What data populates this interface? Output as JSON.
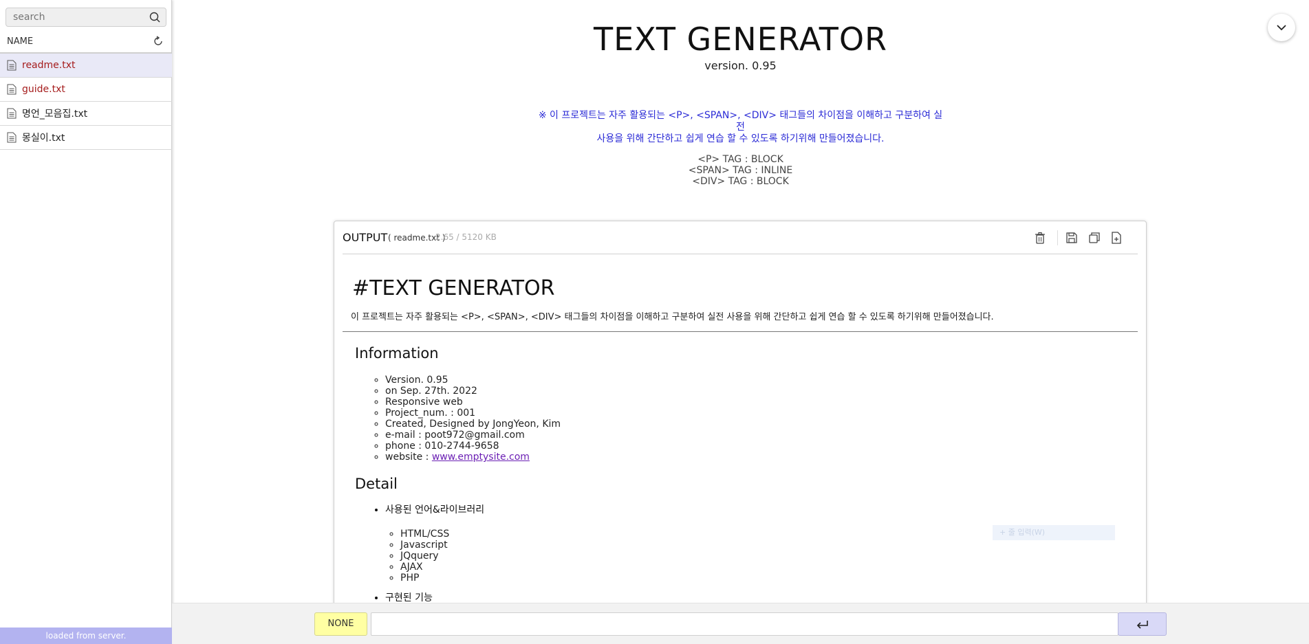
{
  "sidebar": {
    "search_placeholder": "search",
    "column_header": "NAME",
    "files": [
      {
        "name": "readme.txt",
        "selected": true
      },
      {
        "name": "guide.txt",
        "selected": false
      },
      {
        "name": "명언_모음집.txt",
        "selected": false
      },
      {
        "name": "몽실이.txt",
        "selected": false
      }
    ],
    "status": "loaded from server."
  },
  "header": {
    "title": "TEXT GENERATOR",
    "version": "version. 0.95",
    "notice_line1": "※ 이 프로젝트는 자주 활용되는 <P>, <SPAN>, <DIV> 태그들의 차이점을 이해하고 구분하여 실전",
    "notice_line2": "사용을 위해 간단하고 쉽게 연습 할 수 있도록 하기위해 만들어졌습니다.",
    "tags": [
      "<P> TAG : BLOCK",
      "<SPAN> TAG : INLINE",
      "<DIV> TAG : BLOCK"
    ]
  },
  "output": {
    "label": "OUTPUT",
    "file": "( readme.txt )",
    "size": "2.65 / 5120 KB",
    "doc": {
      "h1": "#TEXT GENERATOR",
      "intro": "이 프로젝트는 자주 활용되는 <P>, <SPAN>, <DIV> 태그들의 차이점을 이해하고 구분하여 실전 사용을 위해 간단하고 쉽게 연습 할 수 있도록 하기위해 만들어졌습니다.",
      "info_heading": "Information",
      "info": [
        "Version. 0.95",
        "on Sep. 27th. 2022",
        "Responsive web",
        "Project_num. : 001",
        "Created, Designed by JongYeon, Kim",
        "e-mail : poot972@gmail.com",
        "phone : 010-2744-9658"
      ],
      "website_label": "website : ",
      "website_link": "www.emptysite.com",
      "detail_heading": "Detail",
      "detail_item1": "사용된 언어&라이브러리",
      "libs": [
        "HTML/CSS",
        "Javascript",
        "JQquery",
        "AJAX",
        "PHP"
      ],
      "detail_item2": "구현된 기능"
    },
    "faded_hint": "+  줄 입력(W)"
  },
  "bottom": {
    "mode_button": "NONE",
    "input_value": ""
  },
  "colors": {
    "accent_blue": "#2b2bd6",
    "file_red": "#a51c1c",
    "status_bar": "#b3b3f0",
    "mode_yellow": "#ffffa3",
    "enter_purple": "#d9d9f7"
  }
}
